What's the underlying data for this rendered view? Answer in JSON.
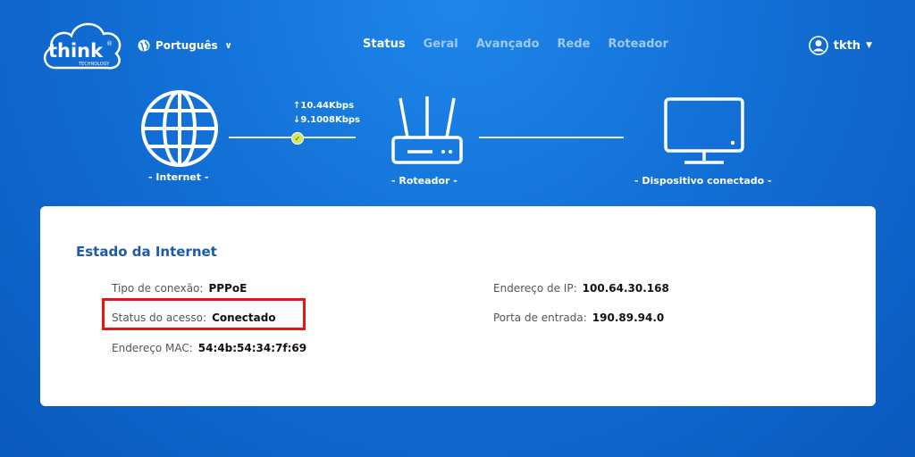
{
  "header": {
    "logo": {
      "text": "think",
      "sub": "TECHNOLOGY",
      "mark": "®"
    },
    "language": "Português",
    "nav": [
      "Status",
      "Geral",
      "Avançado",
      "Rede",
      "Roteador"
    ],
    "active_nav": "Status",
    "user": "tkth"
  },
  "topology": {
    "internet_label": "- Internet -",
    "router_label": "- Roteador -",
    "device_label": "- Dispositivo conectado -",
    "upload": "↑10.44Kbps",
    "download": "↓9.1008Kbps"
  },
  "card": {
    "title": "Estado da Internet",
    "left": [
      {
        "label": "Tipo de conexão:",
        "value": "PPPoE"
      },
      {
        "label": "Status do acesso:",
        "value": "Conectado"
      },
      {
        "label": "Endereço MAC:",
        "value": "54:4b:54:34:7f:69"
      }
    ],
    "right": [
      {
        "label": "Endereço de IP:",
        "value": "100.64.30.168"
      },
      {
        "label": "Porta de entrada:",
        "value": "190.89.94.0"
      }
    ]
  },
  "colors": {
    "background": "#1270d6",
    "accent_title": "#1d5aa8",
    "highlight": "#e21818",
    "link_ok": "#d8e65a"
  }
}
